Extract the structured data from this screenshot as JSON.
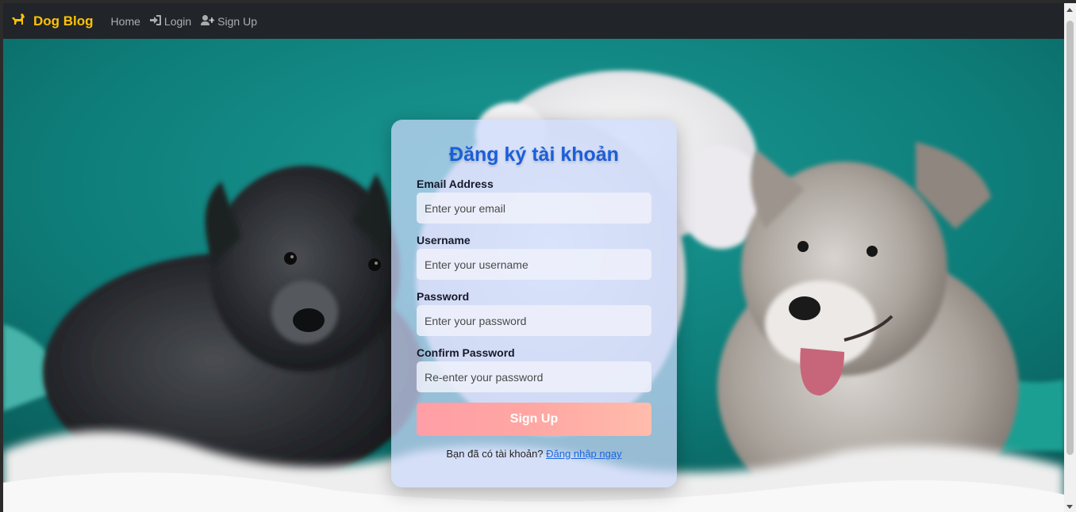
{
  "navbar": {
    "brand": "Dog Blog",
    "links": [
      {
        "label": "Home",
        "icon": "home"
      },
      {
        "label": "Login",
        "icon": "sign-in-icon"
      },
      {
        "label": "Sign Up",
        "icon": "user-plus-icon"
      }
    ]
  },
  "form": {
    "title": "Đăng ký tài khoản",
    "fields": [
      {
        "label": "Email Address",
        "placeholder": "Enter your email",
        "type": "email"
      },
      {
        "label": "Username",
        "placeholder": "Enter your username",
        "type": "text"
      },
      {
        "label": "Password",
        "placeholder": "Enter your password",
        "type": "password"
      },
      {
        "label": "Confirm Password",
        "placeholder": "Re-enter your password",
        "type": "password"
      }
    ],
    "submit_label": "Sign Up",
    "footer_text": "Bạn đã có tài khoản?",
    "footer_link": "Đăng nhập ngay"
  },
  "colors": {
    "navbar_bg": "#212529",
    "brand": "#ffc107",
    "title": "#1a5fd8",
    "button_start": "#ff9ea6",
    "button_end": "#ffbcac",
    "link": "#1b66e0"
  }
}
